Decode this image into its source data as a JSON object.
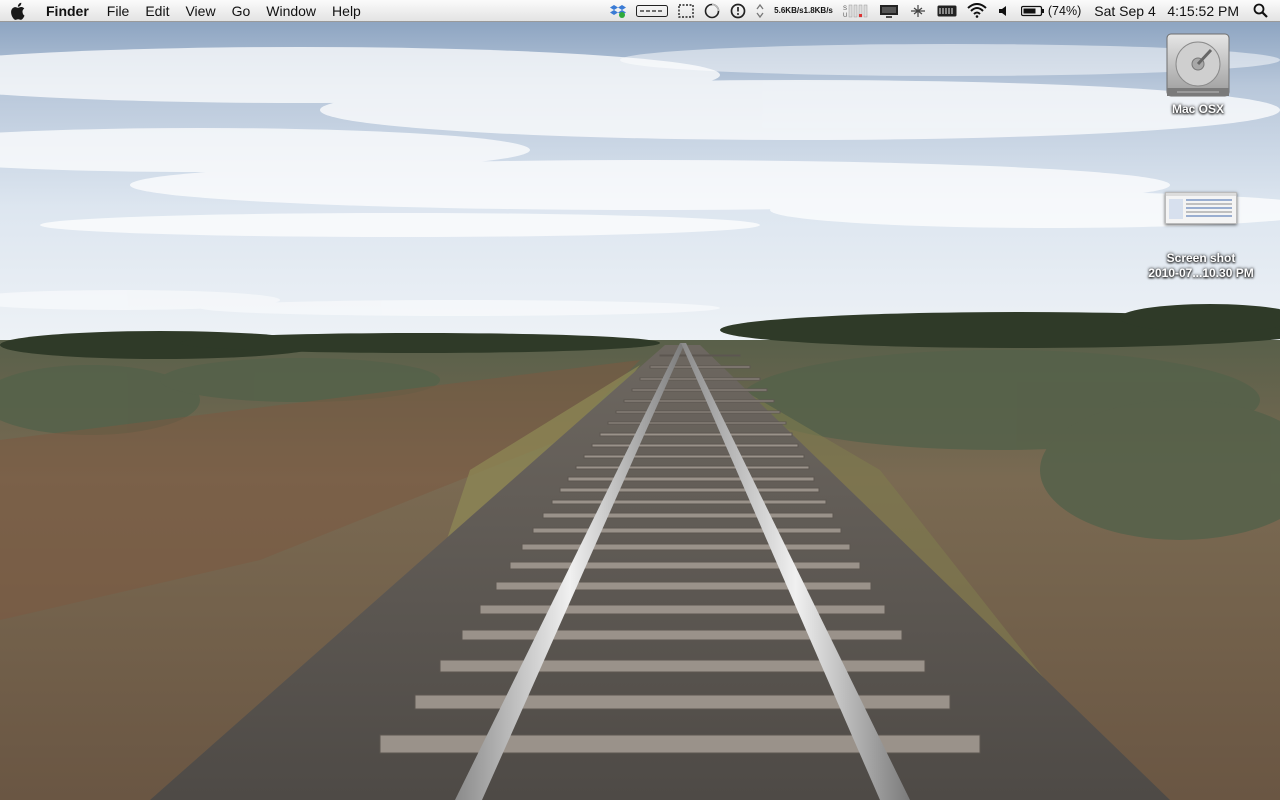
{
  "menubar": {
    "app_name": "Finder",
    "menus": [
      "File",
      "Edit",
      "View",
      "Go",
      "Window",
      "Help"
    ],
    "net_up": "5.6KB/s",
    "net_down": "1.8KB/s",
    "battery_percent": "(74%)",
    "clock": "Sat Sep 4   4:15:52 PM",
    "status_icons": [
      "dropbox-icon",
      "keyboard-icon",
      "selection-icon",
      "activity-icon",
      "time-machine-icon",
      "arrows-icon",
      "net-speed",
      "memory-meter-icon",
      "display-icon",
      "bluetooth-icon",
      "menu-meters-icon",
      "wifi-icon",
      "volume-icon",
      "battery-icon",
      "spotlight-icon"
    ]
  },
  "desktop": {
    "icons": [
      {
        "label": "Mac OSX",
        "icon": "hard-drive-icon"
      },
      {
        "label_line1": "Screen shot",
        "label_line2": "2010-07...10.30 PM",
        "icon": "screenshot-thumbnail-icon"
      }
    ]
  },
  "wallpaper": {
    "description_colors": {
      "sky": "#c9d6e6",
      "ground": "#6e5a45",
      "rail": "#c8c8c8"
    }
  }
}
